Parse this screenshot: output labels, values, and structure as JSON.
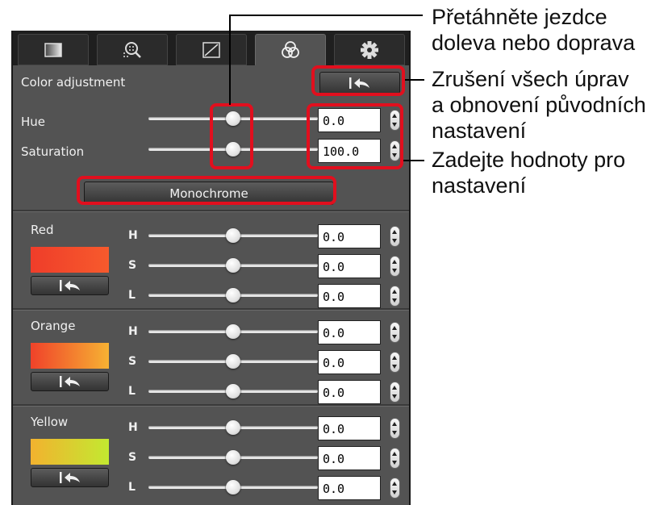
{
  "tabs": [
    {
      "icon": "basic-image-adjustment-icon",
      "active": false
    },
    {
      "icon": "noise-lens-correction-icon",
      "active": false
    },
    {
      "icon": "tone-curve-icon",
      "active": false
    },
    {
      "icon": "color-adjustment-icon",
      "active": true
    },
    {
      "icon": "settings-gear-icon",
      "active": false
    }
  ],
  "color_adjustment": {
    "title": "Color adjustment",
    "reset_icon": "reset-arrow-icon",
    "hue": {
      "label": "Hue",
      "value": "0.0",
      "position": 0.5
    },
    "saturation": {
      "label": "Saturation",
      "value": "100.0",
      "position": 0.5
    },
    "monochrome_label": "Monochrome"
  },
  "colors": [
    {
      "name": "Red",
      "swatch_color": "#f54a2a",
      "rows": [
        {
          "label": "H",
          "value": "0.0",
          "position": 0.5
        },
        {
          "label": "S",
          "value": "0.0",
          "position": 0.5
        },
        {
          "label": "L",
          "value": "0.0",
          "position": 0.5
        }
      ]
    },
    {
      "name": "Orange",
      "swatch_color": "#f38a2c",
      "rows": [
        {
          "label": "H",
          "value": "0.0",
          "position": 0.5
        },
        {
          "label": "S",
          "value": "0.0",
          "position": 0.5
        },
        {
          "label": "L",
          "value": "0.0",
          "position": 0.5
        }
      ]
    },
    {
      "name": "Yellow",
      "swatch_color": "#c9e530",
      "rows": [
        {
          "label": "H",
          "value": "0.0",
          "position": 0.5
        },
        {
          "label": "S",
          "value": "0.0",
          "position": 0.5
        },
        {
          "label": "L",
          "value": "0.0",
          "position": 0.5
        }
      ]
    }
  ],
  "callouts": {
    "drag_sliders": [
      "Přetáhněte jezdce",
      "doleva nebo doprava"
    ],
    "reset_all": [
      "Zrušení všech úprav",
      "a obnovení původních",
      "nastavení"
    ],
    "enter_values": [
      "Zadejte hodnoty pro",
      "nastavení"
    ]
  },
  "highlight_color": "#e10f1e"
}
